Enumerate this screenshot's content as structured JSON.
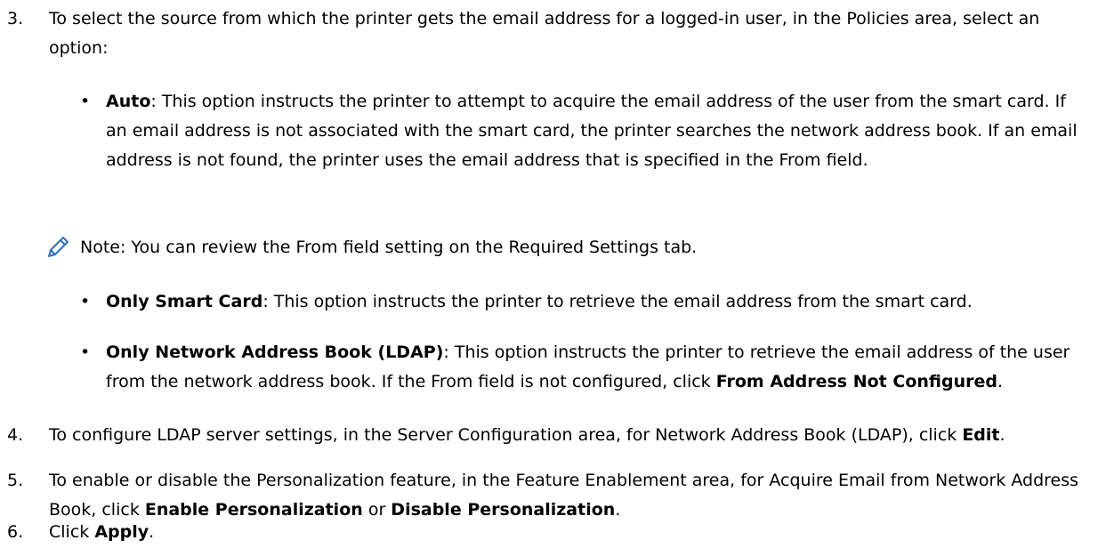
{
  "steps": {
    "s3": {
      "num": "3.",
      "text": "To select the source from which the printer gets the email address for a logged-in user, in the Policies area, select an option:",
      "bullets": [
        {
          "term": "Auto",
          "desc": ": This option instructs the printer to attempt to acquire the email address of the user from the smart card. If an email address is not associated with the smart card, the printer searches the network address book. If an email address is not found, the printer uses the email address that is specified in the From field."
        },
        {
          "term": "Only Smart Card",
          "desc": ": This option instructs the printer to retrieve the email address from the smart card."
        },
        {
          "term": "Only Network Address Book (LDAP)",
          "desc": ": This option instructs the printer to retrieve the email address of the user from the network address book. If the From field is not configured, click ",
          "term2": "From Address Not Configured",
          "end": "."
        }
      ],
      "note": "Note: You can review the From field setting on the Required Settings tab."
    },
    "s4": {
      "num": "4.",
      "pre": "To configure LDAP server settings, in the Server Configuration area, for Network Address Book (LDAP), click ",
      "b1": "Edit",
      "post": "."
    },
    "s5": {
      "num": "5.",
      "pre": "To enable or disable the Personalization feature, in the Feature Enablement area, for Acquire Email from Network Address Book, click ",
      "b1": "Enable Personalization",
      "mid": " or ",
      "b2": "Disable Personalization",
      "post": "."
    },
    "s6": {
      "num": "6.",
      "pre": "Click ",
      "b1": "Apply",
      "post": "."
    }
  },
  "icons": {
    "note": "pencil-icon",
    "note_color": "#2a6fcf"
  }
}
